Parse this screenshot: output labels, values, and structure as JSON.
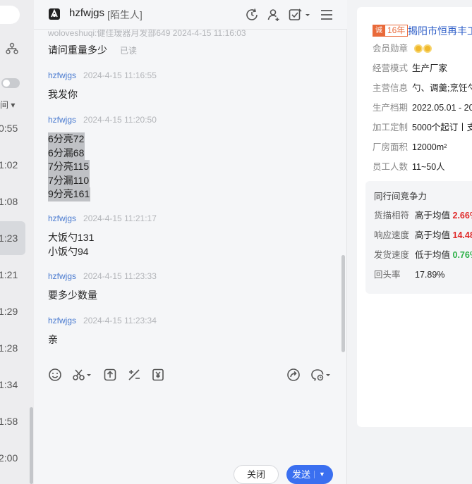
{
  "left_list": {
    "filter_label": "间",
    "times": [
      {
        "t": "0:55",
        "active": false
      },
      {
        "t": "1:02",
        "active": false
      },
      {
        "t": "1:08",
        "active": false
      },
      {
        "t": "1:23",
        "active": true
      },
      {
        "t": "1:21",
        "active": false
      },
      {
        "t": "1:29",
        "active": false
      },
      {
        "t": "1:28",
        "active": false
      },
      {
        "t": "1:34",
        "active": false
      },
      {
        "t": "1:58",
        "active": false
      },
      {
        "t": "2:00",
        "active": false
      }
    ]
  },
  "chat": {
    "contact_name": "hzfwjgs",
    "contact_tag": "[陌生人]",
    "cut_meta": "woloveshuqi:健佳瑷器月发部649  2024-4-15 11:16:03",
    "messages": [
      {
        "sender": "",
        "ts": "",
        "lines": [
          "请问重量多少"
        ],
        "read": "已读"
      },
      {
        "sender": "hzfwjgs",
        "ts": "2024-4-15 11:16:55",
        "lines": [
          "我发你"
        ]
      },
      {
        "sender": "hzfwjgs",
        "ts": "2024-4-15 11:20:50",
        "lines": [
          "6分亮72",
          "6分漏68",
          "7分亮115",
          "7分漏110",
          "9分亮161"
        ]
      },
      {
        "sender": "hzfwjgs",
        "ts": "2024-4-15 11:21:17",
        "lines": [
          "大饭勺131",
          "小饭勺94"
        ]
      },
      {
        "sender": "hzfwjgs",
        "ts": "2024-4-15 11:23:33",
        "lines": [
          "要多少数量"
        ]
      },
      {
        "sender": "hzfwjgs",
        "ts": "2024-4-15 11:23:34",
        "lines": [
          "亲"
        ]
      }
    ],
    "buttons": {
      "close": "关闭",
      "send": "发送",
      "send_caret": "▼"
    }
  },
  "profile": {
    "years_icon": "诚",
    "years": "16年",
    "company": "揭阳市恒再丰工",
    "rows": [
      {
        "k": "会员勋章",
        "v": ""
      },
      {
        "k": "经营模式",
        "v": "生产厂家"
      },
      {
        "k": "主营信息",
        "v": "勺、调羹;烹饪勺"
      },
      {
        "k": "生产档期",
        "v": "2022.05.01 - 20"
      },
      {
        "k": "加工定制",
        "v": "5000个起订丨支"
      },
      {
        "k": "厂房面积",
        "v": "12000m²"
      },
      {
        "k": "员工人数",
        "v": "11~50人"
      }
    ],
    "compete": {
      "title": "同行间竞争力",
      "rows": [
        {
          "k": "货描相符",
          "label": "高于均值",
          "value": "2.66%",
          "color": "red"
        },
        {
          "k": "响应速度",
          "label": "高于均值",
          "value": "14.48",
          "color": "red"
        },
        {
          "k": "发货速度",
          "label": "低于均值",
          "value": "0.76%",
          "color": "green"
        },
        {
          "k": "回头率",
          "label": "",
          "value": "17.89%",
          "color": "plain"
        }
      ]
    }
  }
}
